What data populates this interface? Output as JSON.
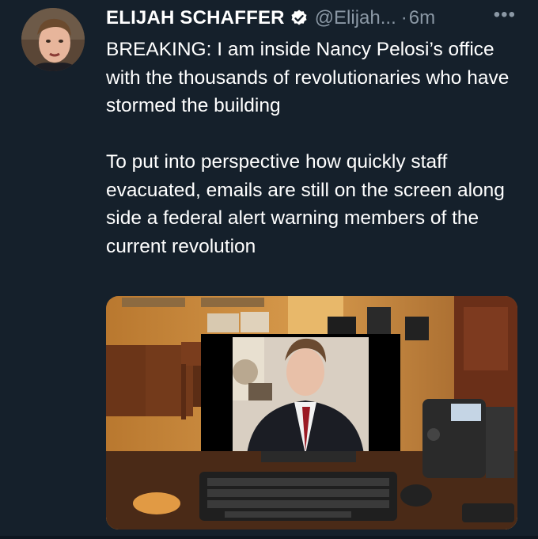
{
  "author": {
    "name": "ELIJAH SCHAFFER",
    "handle": "@Elijah...",
    "separator": "·",
    "time": "6m",
    "verified": true,
    "avatar_icon": "profile-photo"
  },
  "more_label": "•••",
  "tweet_text": "BREAKING: I am inside Nancy Pelosi’s office with the thousands of revolutionaries who have stormed the building\n\nTo put into perspective how quickly staff evacuated, emails are still on the screen along side a federal alert warning members of the current revolution",
  "media": {
    "icon": "attached-photo",
    "colors": {
      "wall": "#c98a3e",
      "desk": "#3d2415",
      "black_box": "#000000"
    }
  },
  "colors": {
    "background": "#15202b",
    "text": "#ffffff",
    "secondary": "#8b98a5",
    "verified": "#ffffff"
  }
}
